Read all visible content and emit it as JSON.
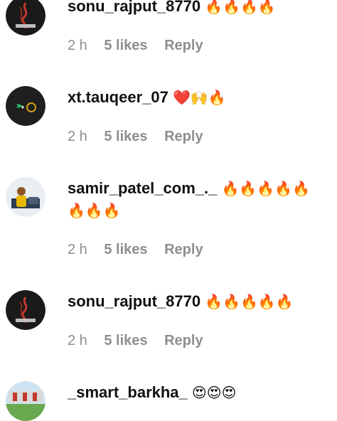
{
  "comments": [
    {
      "username": "sonu_rajput_8770",
      "emoji_line1": "🔥🔥🔥🔥",
      "emoji_line2": "",
      "time": "2 h",
      "likes": "5 likes",
      "reply": "Reply"
    },
    {
      "username": "xt.tauqeer_07",
      "emoji_line1": "❤️🙌🔥",
      "emoji_line2": "",
      "time": "2 h",
      "likes": "5 likes",
      "reply": "Reply"
    },
    {
      "username": "samir_patel_com_._",
      "emoji_line1": "🔥🔥🔥🔥🔥",
      "emoji_line2": "🔥🔥🔥",
      "time": "2 h",
      "likes": "5 likes",
      "reply": "Reply"
    },
    {
      "username": "sonu_rajput_8770",
      "emoji_line1": "🔥🔥🔥🔥🔥",
      "emoji_line2": "",
      "time": "2 h",
      "likes": "5 likes",
      "reply": "Reply"
    },
    {
      "username": "_smart_barkha_",
      "emoji_line1": "😍😍😍",
      "emoji_line2": "",
      "time": "",
      "likes": "",
      "reply": ""
    }
  ],
  "colors": {
    "text": "#111111",
    "meta": "#8e8e8e",
    "fire": "#ff7a00",
    "heart": "#e01e1e"
  }
}
